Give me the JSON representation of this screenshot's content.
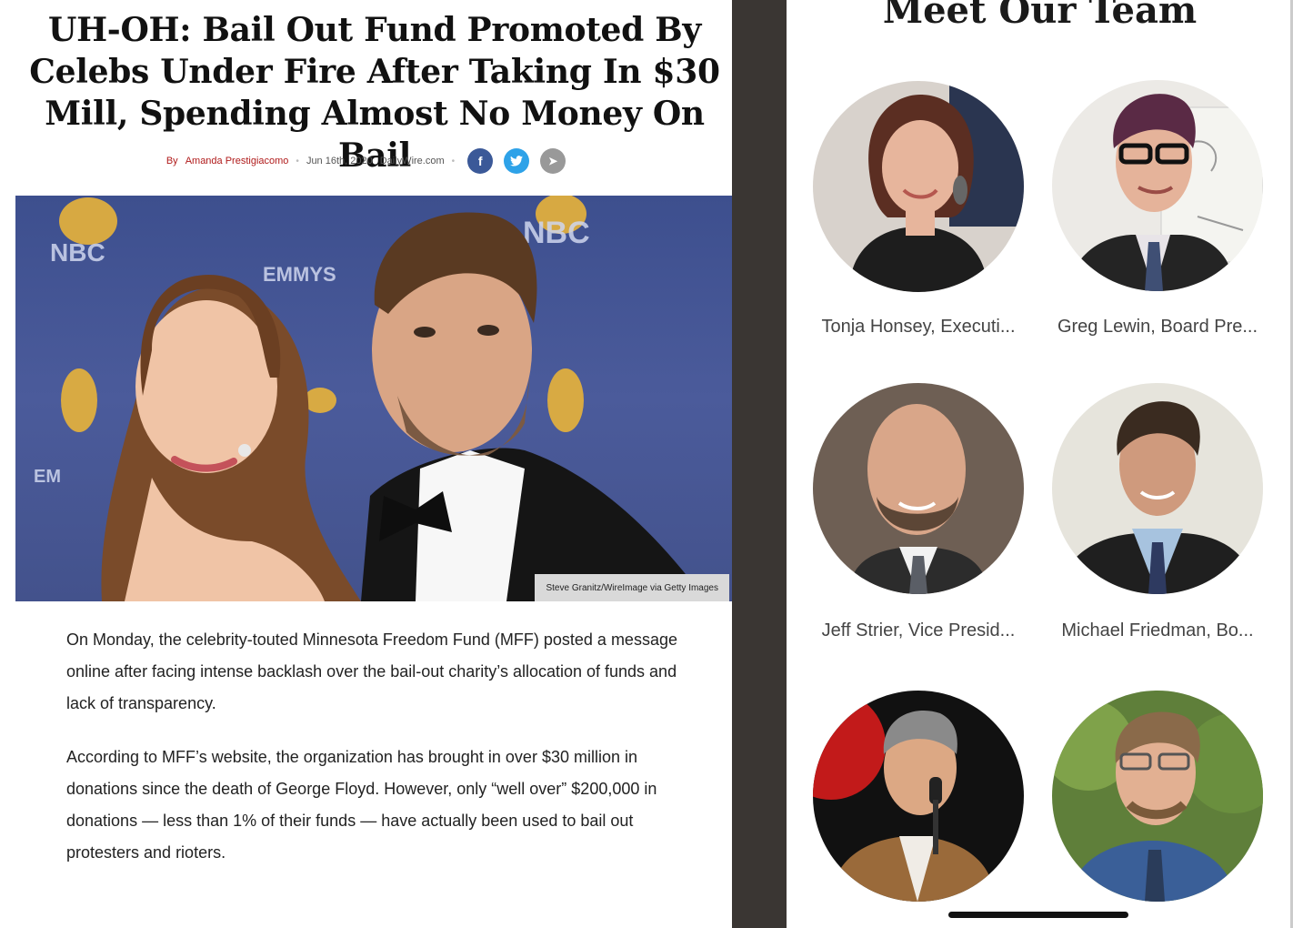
{
  "article": {
    "headline": "UH-OH: Bail Out Fund Promoted By Celebs Under Fire After Taking In $30 Mill, Spending Almost No Money On Bail",
    "by_label": "By",
    "author": "Amanda Prestigiacomo",
    "date": "Jun 16th, 2020",
    "source": "DailyWire.com",
    "share": {
      "facebook": "f",
      "twitter": "t",
      "telegram": "➤"
    },
    "photo_caption": "Steve Granitz/WireImage via Getty Images",
    "paragraphs": [
      "On Monday, the celebrity-touted Minnesota Freedom Fund (MFF) posted a message online after facing intense backlash over the bail-out charity’s allocation of funds and lack of transparency.",
      "According to MFF’s website, the organization has brought in over $30 million in donations since the death of George Floyd. However, only “well over” $200,000 in donations — less than 1% of their funds — have actually been used to bail out protesters and rioters."
    ]
  },
  "team": {
    "title": "Meet Our Team",
    "members": [
      {
        "name": "Tonja Honsey, Executi..."
      },
      {
        "name": "Greg Lewin, Board Pre..."
      },
      {
        "name": "Jeff Strier, Vice Presid..."
      },
      {
        "name": "Michael Friedman, Bo..."
      },
      {
        "name": ""
      },
      {
        "name": ""
      }
    ]
  },
  "colors": {
    "author_red": "#b01b1b",
    "facebook": "#3b5998",
    "twitter": "#2ea2e8",
    "divider": "#3a3633"
  }
}
